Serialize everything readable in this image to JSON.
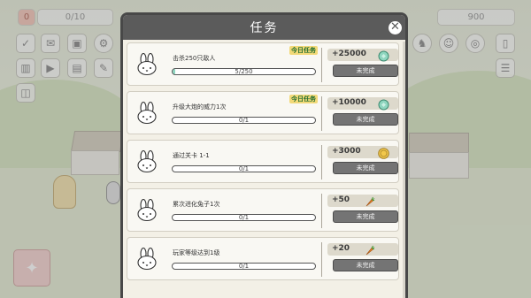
{
  "hud": {
    "left_value": "0",
    "left_progress": "0/10",
    "right_value": "900"
  },
  "modal": {
    "title": "任务",
    "close_label": "✕"
  },
  "tasks": [
    {
      "title": "击杀250只敌人",
      "progress_text": "5/250",
      "progress": 0.02,
      "daily_badge": "今日任务",
      "reward": "+25000",
      "reward_icon": "green-gem-icon",
      "status": "未完成"
    },
    {
      "title": "升级大炮的威力1次",
      "progress_text": "0/1",
      "progress": 0,
      "daily_badge": "今日任务",
      "reward": "+10000",
      "reward_icon": "green-gem-icon",
      "status": "未完成"
    },
    {
      "title": "通过关卡 1-1",
      "progress_text": "0/1",
      "progress": 0,
      "daily_badge": "",
      "reward": "+3000",
      "reward_icon": "gold-coin-icon",
      "status": "未完成"
    },
    {
      "title": "累次进化兔子1次",
      "progress_text": "0/1",
      "progress": 0,
      "daily_badge": "",
      "reward": "+50",
      "reward_icon": "carrot-icon",
      "status": "未完成"
    },
    {
      "title": "玩家等级达到1级",
      "progress_text": "0/1",
      "progress": 0,
      "daily_badge": "",
      "reward": "+20",
      "reward_icon": "carrot-icon",
      "status": "未完成"
    }
  ],
  "colors": {
    "progress_fill": "#8fd6bf",
    "header": "#5b5b5b",
    "daily_badge_bg": "#f2d978",
    "daily_badge_text": "#1f6d2f"
  }
}
